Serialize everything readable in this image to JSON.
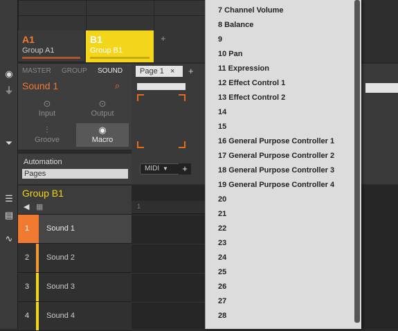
{
  "groups": [
    {
      "name": "A1",
      "label": "Group A1"
    },
    {
      "name": "B1",
      "label": "Group B1"
    }
  ],
  "group_add": "+",
  "sound_tabs": [
    "MASTER",
    "GROUP",
    "SOUND"
  ],
  "sound_name": "Sound 1",
  "tiles": [
    "Input",
    "Output",
    "Groove",
    "Macro"
  ],
  "automation": {
    "label": "Automation",
    "field": "Pages"
  },
  "page_tab": {
    "label": "Page 1",
    "close": "×",
    "add": "+"
  },
  "midi": {
    "label": "MIDI",
    "add": "+"
  },
  "group_header": {
    "title": "Group B1"
  },
  "sounds": [
    {
      "num": "1",
      "label": "Sound 1"
    },
    {
      "num": "2",
      "label": "Sound 2"
    },
    {
      "num": "3",
      "label": "Sound 3"
    },
    {
      "num": "4",
      "label": "Sound 4"
    }
  ],
  "ruler": "1",
  "menu_items": [
    "7 Channel Volume",
    "8 Balance",
    "9",
    "10 Pan",
    "11 Expression",
    "12 Effect Control 1",
    "13 Effect Control 2",
    "14",
    "15",
    "16 General Purpose Controller 1",
    "17 General Purpose Controller 2",
    "18 General Purpose Controller 3",
    "19 General Purpose Controller 4",
    "20",
    "21",
    "22",
    "23",
    "24",
    "25",
    "26",
    "27",
    "28"
  ],
  "colors": {
    "accent_orange": "#f07a30",
    "accent_yellow": "#f3d51c",
    "selected_sound": "#f07a30",
    "menu_bg": "#dcdcdc"
  }
}
